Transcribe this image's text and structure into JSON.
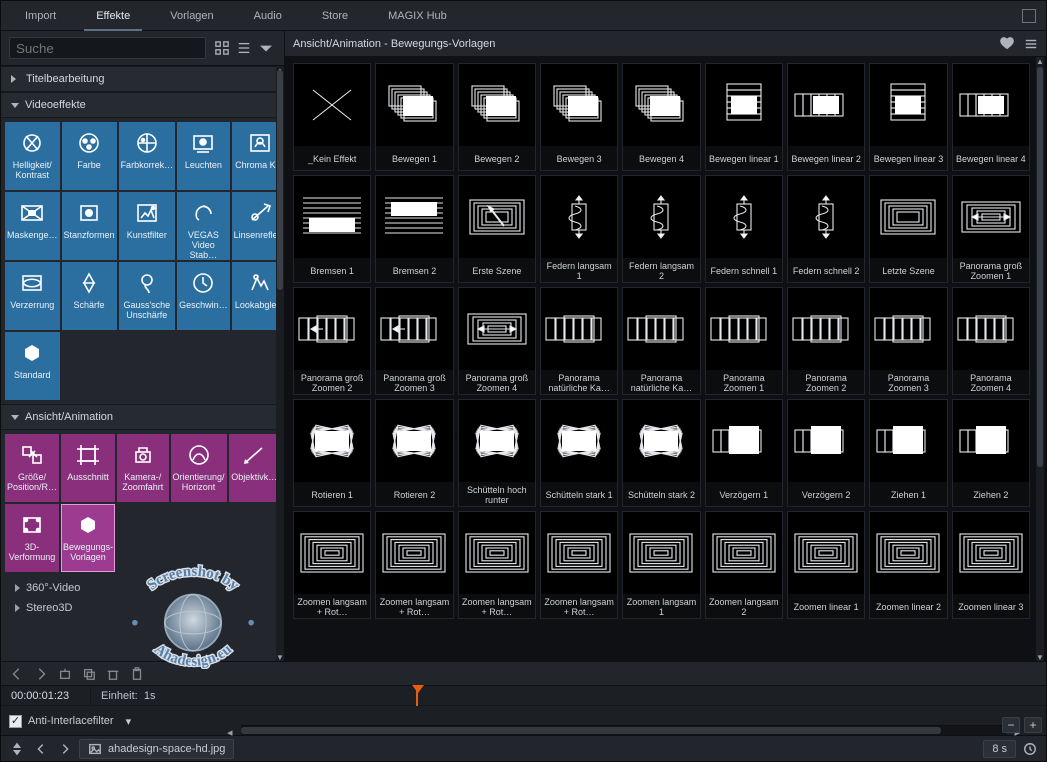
{
  "tabs": [
    "Import",
    "Effekte",
    "Vorlagen",
    "Audio",
    "Store",
    "MAGIX Hub"
  ],
  "activeTab": 1,
  "search": {
    "placeholder": "Suche"
  },
  "sections": {
    "title_edit": "Titelbearbeitung",
    "vfx": "Videoeffekte",
    "anim": "Ansicht/Animation",
    "v360": "360°-Video",
    "stereo": "Stereo3D"
  },
  "vfx_tiles": [
    "Helligkeit/\nKontrast",
    "Farbe",
    "Farbkorrek…",
    "Leuchten",
    "Chroma Key",
    "Maskenge…",
    "Stanzformen",
    "Kunstfilter",
    "VEGAS\nVideo Stab…",
    "Linsenrefle…",
    "Verzerrung",
    "Schärfe",
    "Gauss'sche\nUnschärfe",
    "Geschwin…",
    "Lookabgle…",
    "Standard"
  ],
  "anim_tiles": [
    "Größe/\nPosition/R…",
    "Ausschnitt",
    "Kamera-/\nZoomfahrt",
    "Orientierung/\nHorizont",
    "Objektivk…",
    "3D-\nVerformung",
    "Bewegungs-\nVorlagen"
  ],
  "anim_selected": 6,
  "right_header": "Ansicht/Animation - Bewegungs-Vorlagen",
  "gallery": [
    "_Kein Effekt",
    "Bewegen 1",
    "Bewegen 2",
    "Bewegen 3",
    "Bewegen 4",
    "Bewegen linear 1",
    "Bewegen linear 2",
    "Bewegen linear 3",
    "Bewegen linear 4",
    "Bremsen 1",
    "Bremsen 2",
    "Erste Szene",
    "Federn langsam 1",
    "Federn langsam 2",
    "Federn schnell 1",
    "Federn schnell 2",
    "Letzte Szene",
    "Panorama groß Zoomen 1",
    "Panorama groß Zoomen 2",
    "Panorama groß Zoomen 3",
    "Panorama groß Zoomen 4",
    "Panorama natürliche Ka…",
    "Panorama natürliche Ka…",
    "Panorama Zoomen 1",
    "Panorama Zoomen 2",
    "Panorama Zoomen 3",
    "Panorama Zoomen 4",
    "Rotieren 1",
    "Rotieren 2",
    "Schütteln hoch runter",
    "Schütteln stark 1",
    "Schütteln stark 2",
    "Verzögern 1",
    "Verzögern 2",
    "Ziehen 1",
    "Ziehen 2",
    "Zoomen langsam + Rot…",
    "Zoomen langsam + Rot…",
    "Zoomen langsam + Rot…",
    "Zoomen langsam + Rot…",
    "Zoomen langsam 1",
    "Zoomen langsam 2",
    "Zoomen linear 1",
    "Zoomen linear 2",
    "Zoomen linear 3"
  ],
  "timeline": {
    "timecode": "00:00:01:23",
    "unit_label": "Einheit:",
    "unit_value": "1s",
    "filter": "Anti-Interlacefilter"
  },
  "footer": {
    "filename": "ahadesign-space-hd.jpg",
    "duration": "8 s"
  },
  "watermark": {
    "line1": "Screenshot by",
    "line2": "Ahadesign.eu"
  }
}
